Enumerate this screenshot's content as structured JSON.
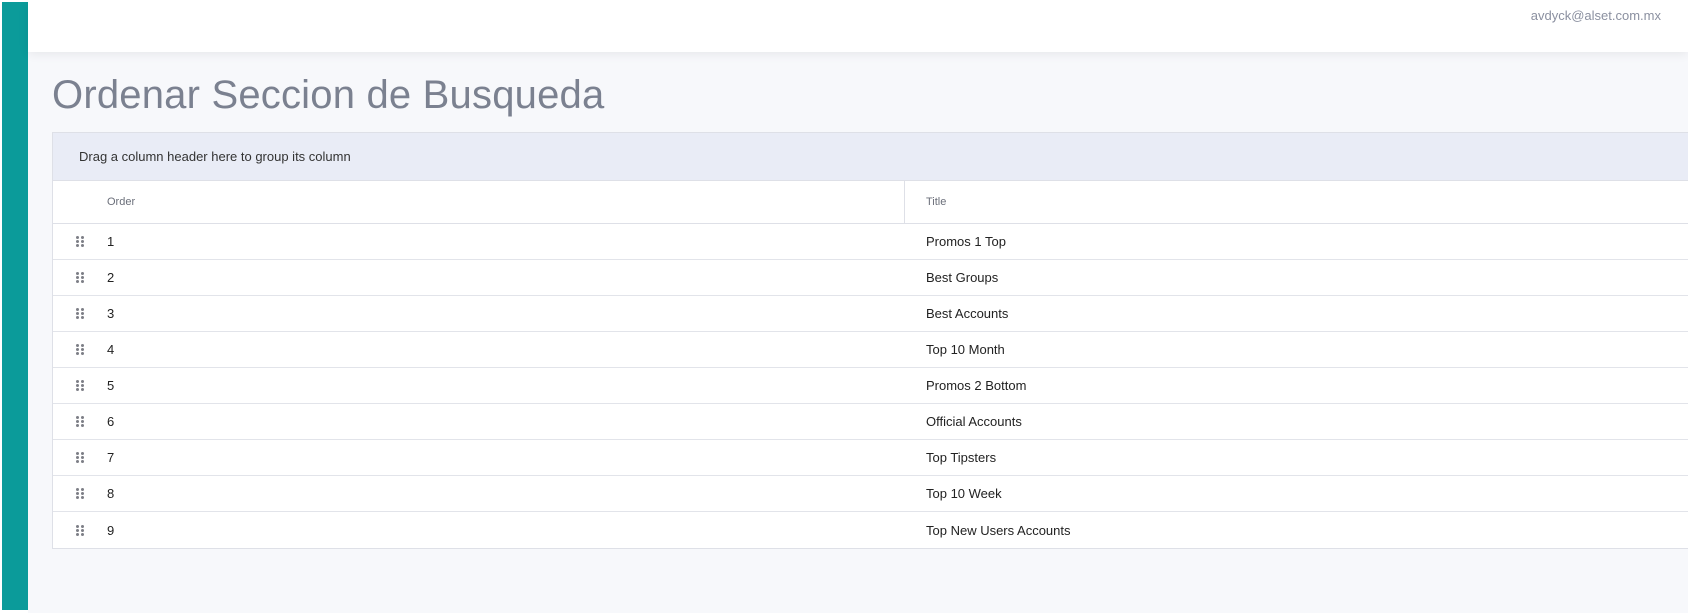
{
  "header": {
    "user_email": "avdyck@alset.com.mx"
  },
  "page": {
    "title": "Ordenar Seccion de Busqueda"
  },
  "grid": {
    "group_panel_text": "Drag a column header here to group its column",
    "columns": {
      "order": "Order",
      "title": "Title"
    },
    "rows": [
      {
        "order": "1",
        "title": "Promos 1 Top"
      },
      {
        "order": "2",
        "title": "Best Groups"
      },
      {
        "order": "3",
        "title": "Best Accounts"
      },
      {
        "order": "4",
        "title": "Top 10 Month"
      },
      {
        "order": "5",
        "title": "Promos 2 Bottom"
      },
      {
        "order": "6",
        "title": "Official Accounts"
      },
      {
        "order": "7",
        "title": "Top Tipsters"
      },
      {
        "order": "8",
        "title": "Top 10 Week"
      },
      {
        "order": "9",
        "title": "Top New Users Accounts"
      }
    ]
  },
  "icons": {
    "drag_handle": "drag-handle-icon"
  },
  "colors": {
    "sidebar": "#0b9b9a",
    "group_panel": "#e9ecf6",
    "title_text": "#7b8190"
  }
}
